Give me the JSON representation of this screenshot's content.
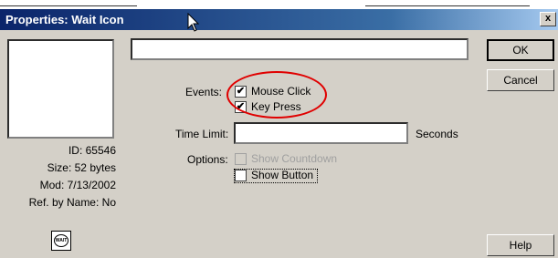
{
  "window": {
    "title": "Properties: Wait Icon",
    "close_label": "x"
  },
  "icon_info": {
    "id": "ID: 65546",
    "size": "Size: 52 bytes",
    "mod": "Mod: 7/13/2002",
    "ref": "Ref. by Name: No",
    "icon_text": "WAIT"
  },
  "name_field": {
    "value": ""
  },
  "events": {
    "label": "Events:",
    "mouse_click": {
      "label": "Mouse Click",
      "checked": true,
      "mark": "✔"
    },
    "key_press": {
      "label": "Key Press",
      "checked": true,
      "mark": "✔"
    }
  },
  "time_limit": {
    "label": "Time Limit:",
    "value": "",
    "units": "Seconds"
  },
  "options": {
    "label": "Options:",
    "show_countdown": {
      "label": "Show Countdown",
      "checked": false,
      "enabled": false
    },
    "show_button": {
      "label": "Show Button",
      "checked": false,
      "enabled": true
    }
  },
  "buttons": {
    "ok": "OK",
    "cancel": "Cancel",
    "help": "Help"
  },
  "colors": {
    "annotation_circle": "#e00000",
    "title_bar": "#0a246a"
  }
}
